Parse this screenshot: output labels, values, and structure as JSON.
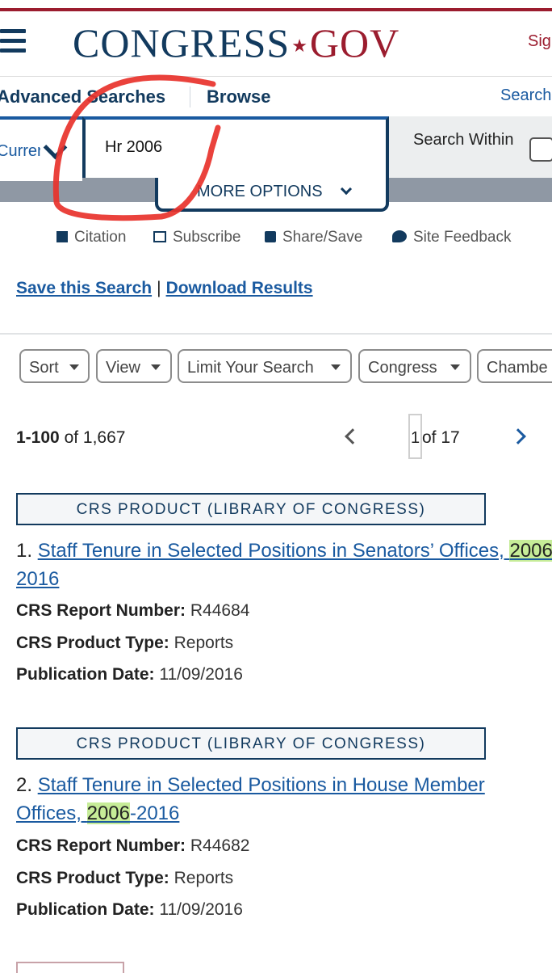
{
  "header": {
    "logo_main": "CONGRESS",
    "logo_dot": "★",
    "logo_suffix": "GOV",
    "signin_label": "Sig"
  },
  "nav": {
    "advanced_searches": "Advanced Searches",
    "browse": "Browse",
    "search_tools": "Search"
  },
  "search": {
    "scope_value": "Currer",
    "query_value": "Hr 2006",
    "search_within_label": "Search Within",
    "more_options_label": "MORE OPTIONS"
  },
  "tools": {
    "citation": "Citation",
    "subscribe": "Subscribe",
    "share_save": "Share/Save",
    "site_feedback": "Site Feedback"
  },
  "actions": {
    "save_search": "Save this Search",
    "separator": "|",
    "download_results": "Download Results"
  },
  "filters": [
    "Sort",
    "View",
    "Limit Your Search",
    "Congress",
    "Chambe"
  ],
  "pagination": {
    "range": "1-100",
    "of_total": "of 1,667",
    "current_page": "1",
    "of_pages": "of 17"
  },
  "results": [
    {
      "type_label": "CRS PRODUCT (LIBRARY OF CONGRESS)",
      "number": "1.",
      "title_before": "Staff Tenure in Selected Positions in Senators’ Offices, ",
      "title_highlight": "2006",
      "title_after": "-2016",
      "report_number_label": "CRS Report Number:",
      "report_number": "R44684",
      "product_type_label": "CRS Product Type:",
      "product_type": "Reports",
      "pub_date_label": "Publication Date:",
      "pub_date": "11/09/2016"
    },
    {
      "type_label": "CRS PRODUCT (LIBRARY OF CONGRESS)",
      "number": "2.",
      "title_before": "Staff Tenure in Selected Positions in House Member Offices, ",
      "title_highlight": "2006",
      "title_after": "-2016",
      "report_number_label": "CRS Report Number:",
      "report_number": "R44682",
      "product_type_label": "CRS Product Type:",
      "product_type": "Reports",
      "pub_date_label": "Publication Date:",
      "pub_date": "11/09/2016"
    }
  ],
  "colors": {
    "brand_navy": "#123a5e",
    "brand_red": "#9b1c2e",
    "link_blue": "#1a5aa0",
    "highlight_green": "#c6ec98",
    "annotation_red": "#e8322b"
  }
}
